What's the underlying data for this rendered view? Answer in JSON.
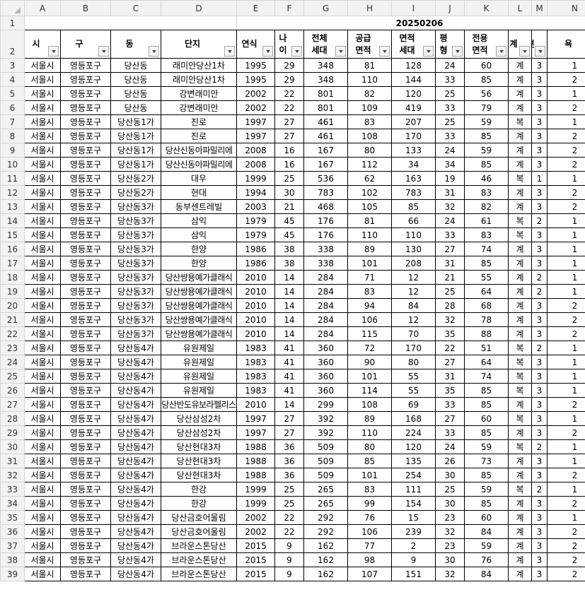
{
  "spreadsheet": {
    "column_letters": [
      "A",
      "B",
      "C",
      "D",
      "E",
      "F",
      "G",
      "H",
      "I",
      "J",
      "K",
      "L",
      "M",
      "N"
    ],
    "date_label": "20250206",
    "headers": [
      "시",
      "구",
      "동",
      "단지",
      "연식",
      "나이",
      "전체\n세대",
      "공급\n면적",
      "면적\n세대",
      "평형",
      "전용\n면적",
      "계",
      "방",
      "욕"
    ],
    "rows": [
      [
        "3",
        "서울시",
        "영등포구",
        "당산동",
        "래미안당산1차",
        "1995",
        "29",
        "348",
        "81",
        "128",
        "24",
        "60",
        "계",
        "3",
        "1"
      ],
      [
        "4",
        "서울시",
        "영등포구",
        "당산동",
        "래미안당산1차",
        "1995",
        "29",
        "348",
        "110",
        "144",
        "33",
        "85",
        "계",
        "3",
        "2"
      ],
      [
        "5",
        "서울시",
        "영등포구",
        "당산동",
        "강변래미안",
        "2002",
        "22",
        "801",
        "82",
        "120",
        "25",
        "56",
        "계",
        "3",
        "1"
      ],
      [
        "6",
        "서울시",
        "영등포구",
        "당산동",
        "강변래미안",
        "2002",
        "22",
        "801",
        "109",
        "419",
        "33",
        "79",
        "계",
        "3",
        "2"
      ],
      [
        "7",
        "서울시",
        "영등포구",
        "당산동1가",
        "진로",
        "1997",
        "27",
        "461",
        "83",
        "207",
        "25",
        "59",
        "복",
        "3",
        "1"
      ],
      [
        "8",
        "서울시",
        "영등포구",
        "당산동1가",
        "진로",
        "1997",
        "27",
        "461",
        "108",
        "170",
        "33",
        "85",
        "계",
        "3",
        "2"
      ],
      [
        "9",
        "서울시",
        "영등포구",
        "당산동1가",
        "당산신동아파밀리에",
        "2008",
        "16",
        "167",
        "80",
        "133",
        "24",
        "59",
        "계",
        "3",
        "2"
      ],
      [
        "10",
        "서울시",
        "영등포구",
        "당산동1가",
        "당산신동아파밀리에",
        "2008",
        "16",
        "167",
        "112",
        "34",
        "34",
        "85",
        "계",
        "3",
        "2"
      ],
      [
        "11",
        "서울시",
        "영등포구",
        "당산동2가",
        "대우",
        "1999",
        "25",
        "536",
        "62",
        "163",
        "19",
        "46",
        "복",
        "1",
        "1"
      ],
      [
        "12",
        "서울시",
        "영등포구",
        "당산동2가",
        "현대",
        "1994",
        "30",
        "783",
        "102",
        "783",
        "31",
        "83",
        "계",
        "3",
        "2"
      ],
      [
        "13",
        "서울시",
        "영등포구",
        "당산동3가",
        "동부센트레빌",
        "2003",
        "21",
        "468",
        "105",
        "85",
        "32",
        "82",
        "계",
        "3",
        "2"
      ],
      [
        "14",
        "서울시",
        "영등포구",
        "당산동3가",
        "삼익",
        "1979",
        "45",
        "176",
        "81",
        "66",
        "24",
        "61",
        "복",
        "2",
        "1"
      ],
      [
        "15",
        "서울시",
        "영등포구",
        "당산동3가",
        "삼익",
        "1979",
        "45",
        "176",
        "110",
        "110",
        "33",
        "83",
        "복",
        "3",
        "1"
      ],
      [
        "16",
        "서울시",
        "영등포구",
        "당산동3가",
        "한양",
        "1986",
        "38",
        "338",
        "89",
        "130",
        "27",
        "74",
        "계",
        "3",
        "1"
      ],
      [
        "17",
        "서울시",
        "영등포구",
        "당산동3가",
        "한양",
        "1986",
        "38",
        "338",
        "101",
        "208",
        "31",
        "85",
        "계",
        "3",
        "1"
      ],
      [
        "18",
        "서울시",
        "영등포구",
        "당산동3가",
        "당산쌍용예가클래식",
        "2010",
        "14",
        "284",
        "71",
        "12",
        "21",
        "55",
        "계",
        "2",
        "1"
      ],
      [
        "19",
        "서울시",
        "영등포구",
        "당산동3가",
        "당산쌍용예가클래식",
        "2010",
        "14",
        "284",
        "83",
        "12",
        "25",
        "64",
        "계",
        "2",
        "1"
      ],
      [
        "20",
        "서울시",
        "영등포구",
        "당산동3가",
        "당산쌍용예가클래식",
        "2010",
        "14",
        "284",
        "94",
        "84",
        "28",
        "68",
        "계",
        "3",
        "2"
      ],
      [
        "21",
        "서울시",
        "영등포구",
        "당산동3가",
        "당산쌍용예가클래식",
        "2010",
        "14",
        "284",
        "106",
        "12",
        "32",
        "78",
        "계",
        "3",
        "2"
      ],
      [
        "22",
        "서울시",
        "영등포구",
        "당산동3가",
        "당산쌍용예가클래식",
        "2010",
        "14",
        "284",
        "115",
        "70",
        "35",
        "88",
        "계",
        "3",
        "2"
      ],
      [
        "23",
        "서울시",
        "영등포구",
        "당산동4가",
        "유원제일",
        "1983",
        "41",
        "360",
        "72",
        "170",
        "22",
        "51",
        "복",
        "2",
        "1"
      ],
      [
        "24",
        "서울시",
        "영등포구",
        "당산동4가",
        "유원제일",
        "1983",
        "41",
        "360",
        "90",
        "80",
        "27",
        "64",
        "복",
        "3",
        "1"
      ],
      [
        "25",
        "서울시",
        "영등포구",
        "당산동4가",
        "유원제일",
        "1983",
        "41",
        "360",
        "101",
        "55",
        "31",
        "74",
        "복",
        "3",
        "1"
      ],
      [
        "26",
        "서울시",
        "영등포구",
        "당산동4가",
        "유원제일",
        "1983",
        "41",
        "360",
        "114",
        "55",
        "35",
        "85",
        "복",
        "3",
        "1"
      ],
      [
        "27",
        "서울시",
        "영등포구",
        "당산동4가",
        "당산반도유보라펠리스",
        "2010",
        "14",
        "299",
        "108",
        "69",
        "33",
        "85",
        "계",
        "3",
        "2"
      ],
      [
        "28",
        "서울시",
        "영등포구",
        "당산동4가",
        "당산삼성2차",
        "1997",
        "27",
        "392",
        "89",
        "168",
        "27",
        "60",
        "복",
        "3",
        "1"
      ],
      [
        "29",
        "서울시",
        "영등포구",
        "당산동4가",
        "당산삼성2차",
        "1997",
        "27",
        "392",
        "110",
        "224",
        "33",
        "85",
        "계",
        "3",
        "2"
      ],
      [
        "30",
        "서울시",
        "영등포구",
        "당산동4가",
        "당산현대3차",
        "1988",
        "36",
        "509",
        "80",
        "120",
        "24",
        "59",
        "복",
        "2",
        "1"
      ],
      [
        "31",
        "서울시",
        "영등포구",
        "당산동4가",
        "당산현대3차",
        "1988",
        "36",
        "509",
        "85",
        "135",
        "26",
        "73",
        "계",
        "3",
        "1"
      ],
      [
        "32",
        "서울시",
        "영등포구",
        "당산동4가",
        "당산현대3차",
        "1988",
        "36",
        "509",
        "101",
        "254",
        "30",
        "85",
        "계",
        "3",
        "2"
      ],
      [
        "33",
        "서울시",
        "영등포구",
        "당산동4가",
        "한강",
        "1999",
        "25",
        "265",
        "83",
        "111",
        "25",
        "59",
        "복",
        "2",
        "1"
      ],
      [
        "34",
        "서울시",
        "영등포구",
        "당산동4가",
        "한강",
        "1999",
        "25",
        "265",
        "99",
        "154",
        "30",
        "85",
        "계",
        "3",
        "2"
      ],
      [
        "35",
        "서울시",
        "영등포구",
        "당산동4가",
        "당산금호어울림",
        "2002",
        "22",
        "292",
        "76",
        "15",
        "23",
        "60",
        "계",
        "3",
        "1"
      ],
      [
        "36",
        "서울시",
        "영등포구",
        "당산동4가",
        "당산금호어울림",
        "2002",
        "22",
        "292",
        "106",
        "239",
        "32",
        "84",
        "계",
        "3",
        "2"
      ],
      [
        "37",
        "서울시",
        "영등포구",
        "당산동4가",
        "브라운스톤당산",
        "2015",
        "9",
        "162",
        "77",
        "2",
        "23",
        "59",
        "계",
        "3",
        "2"
      ],
      [
        "38",
        "서울시",
        "영등포구",
        "당산동4가",
        "브라운스톤당산",
        "2015",
        "9",
        "162",
        "98",
        "9",
        "30",
        "76",
        "계",
        "3",
        "2"
      ],
      [
        "39",
        "서울시",
        "영등포구",
        "당산동4가",
        "브라운스톤당산",
        "2015",
        "9",
        "162",
        "107",
        "151",
        "32",
        "84",
        "계",
        "3",
        "2"
      ]
    ]
  }
}
